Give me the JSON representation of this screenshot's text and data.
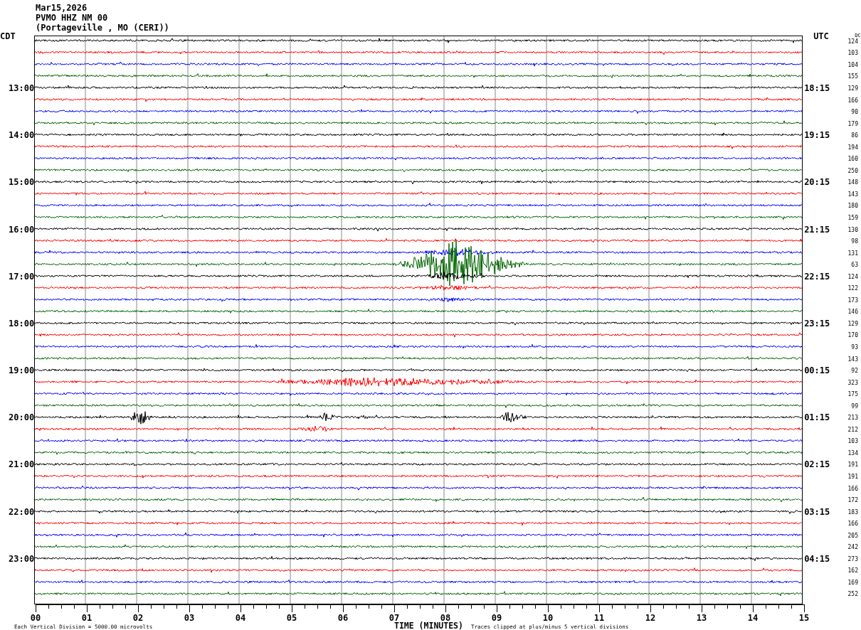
{
  "header": {
    "date": "Mar15,2026",
    "station": "PVMO HHZ NM 00",
    "location": "(Portageville , MO (CERI))"
  },
  "left_zone": "CDT",
  "right_zone": "UTC",
  "dc_header": "DC",
  "traces": [
    {
      "color": "#000000",
      "dc": "124"
    },
    {
      "color": "#ff0000",
      "dc": "103"
    },
    {
      "color": "#0000ff",
      "dc": "104"
    },
    {
      "color": "#006400",
      "dc": "155"
    },
    {
      "color": "#000000",
      "dc": "129",
      "local_time": "13:00",
      "utc_time": "18:15"
    },
    {
      "color": "#ff0000",
      "dc": "166"
    },
    {
      "color": "#0000ff",
      "dc": "90"
    },
    {
      "color": "#006400",
      "dc": "179"
    },
    {
      "color": "#000000",
      "dc": "86",
      "local_time": "14:00",
      "utc_time": "19:15"
    },
    {
      "color": "#ff0000",
      "dc": "194"
    },
    {
      "color": "#0000ff",
      "dc": "160"
    },
    {
      "color": "#006400",
      "dc": "250"
    },
    {
      "color": "#000000",
      "dc": "148",
      "local_time": "15:00",
      "utc_time": "20:15"
    },
    {
      "color": "#ff0000",
      "dc": "143"
    },
    {
      "color": "#0000ff",
      "dc": "180"
    },
    {
      "color": "#006400",
      "dc": "159"
    },
    {
      "color": "#000000",
      "dc": "130",
      "local_time": "16:00",
      "utc_time": "21:15"
    },
    {
      "color": "#ff0000",
      "dc": "98"
    },
    {
      "color": "#0000ff",
      "dc": "131"
    },
    {
      "color": "#006400",
      "dc": "63"
    },
    {
      "color": "#000000",
      "dc": "124",
      "local_time": "17:00",
      "utc_time": "22:15"
    },
    {
      "color": "#ff0000",
      "dc": "122"
    },
    {
      "color": "#0000ff",
      "dc": "173"
    },
    {
      "color": "#006400",
      "dc": "146"
    },
    {
      "color": "#000000",
      "dc": "129",
      "local_time": "18:00",
      "utc_time": "23:15"
    },
    {
      "color": "#ff0000",
      "dc": "170"
    },
    {
      "color": "#0000ff",
      "dc": "93"
    },
    {
      "color": "#006400",
      "dc": "143"
    },
    {
      "color": "#000000",
      "dc": "92",
      "local_time": "19:00",
      "utc_time": "00:15"
    },
    {
      "color": "#ff0000",
      "dc": "323"
    },
    {
      "color": "#0000ff",
      "dc": "175"
    },
    {
      "color": "#006400",
      "dc": "99"
    },
    {
      "color": "#000000",
      "dc": "213",
      "local_time": "20:00",
      "utc_time": "01:15"
    },
    {
      "color": "#ff0000",
      "dc": "212"
    },
    {
      "color": "#0000ff",
      "dc": "103"
    },
    {
      "color": "#006400",
      "dc": "134"
    },
    {
      "color": "#000000",
      "dc": "191",
      "local_time": "21:00",
      "utc_time": "02:15"
    },
    {
      "color": "#ff0000",
      "dc": "191"
    },
    {
      "color": "#0000ff",
      "dc": "166"
    },
    {
      "color": "#006400",
      "dc": "172"
    },
    {
      "color": "#000000",
      "dc": "183",
      "local_time": "22:00",
      "utc_time": "03:15"
    },
    {
      "color": "#ff0000",
      "dc": "166"
    },
    {
      "color": "#0000ff",
      "dc": "205"
    },
    {
      "color": "#006400",
      "dc": "242"
    },
    {
      "color": "#000000",
      "dc": "273",
      "local_time": "23:00",
      "utc_time": "04:15"
    },
    {
      "color": "#ff0000",
      "dc": "162"
    },
    {
      "color": "#0000ff",
      "dc": "169"
    },
    {
      "color": "#006400",
      "dc": "252"
    }
  ],
  "x_axis": {
    "labels": [
      "00",
      "01",
      "02",
      "03",
      "04",
      "05",
      "06",
      "07",
      "08",
      "09",
      "10",
      "11",
      "12",
      "13",
      "14",
      "15"
    ],
    "title": "TIME (MINUTES)"
  },
  "footer": {
    "scale_note": "Each Vertical Division = 5000.00 microvolts",
    "clip_note": "Traces clipped at plus/minus 5 vertical divisions"
  }
}
